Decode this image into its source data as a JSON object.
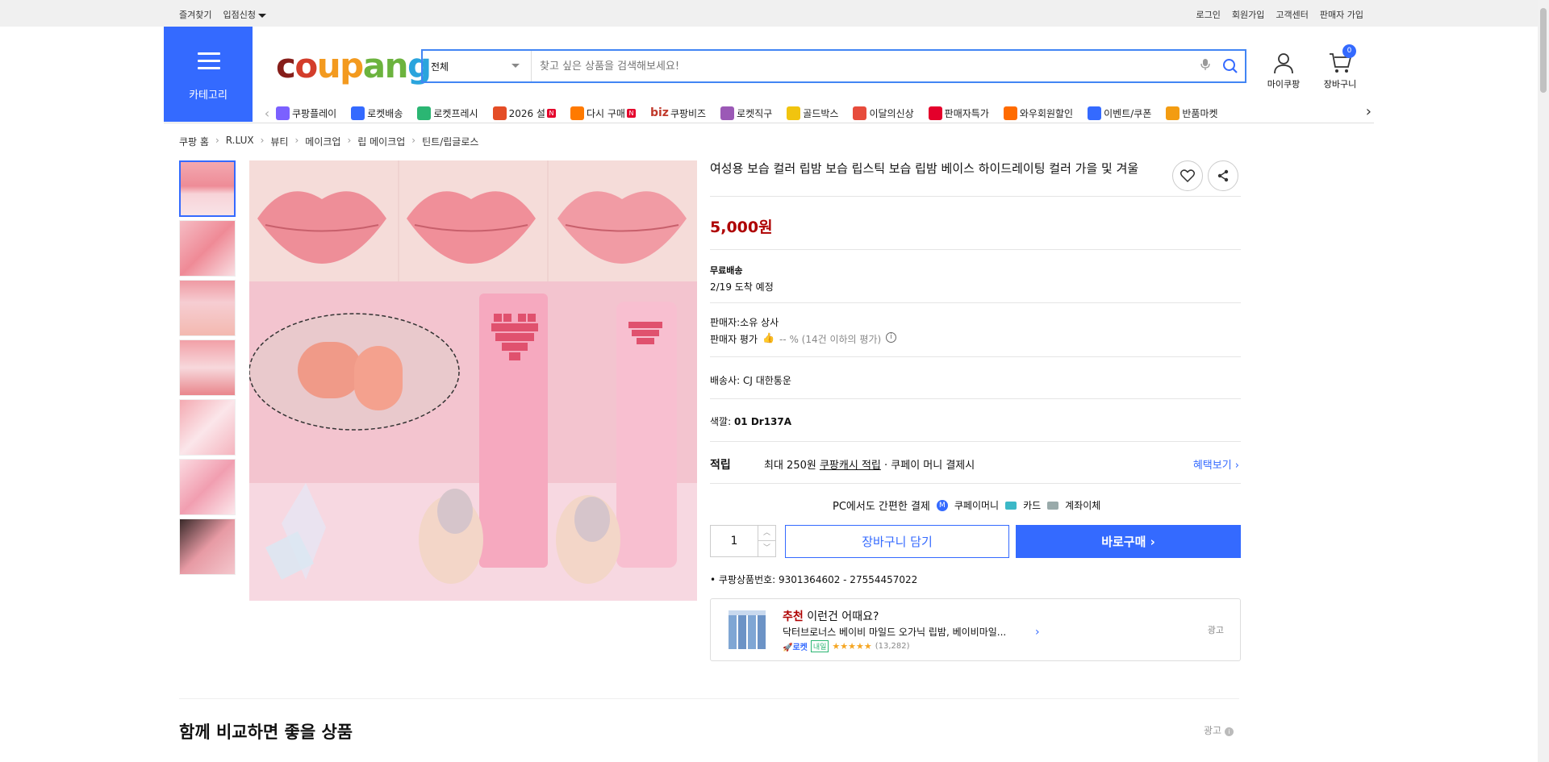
{
  "topbar": {
    "left": [
      "즐겨찾기",
      "입점신청"
    ],
    "right": [
      "로그인",
      "회원가입",
      "고객센터",
      "판매자 가입"
    ]
  },
  "header": {
    "category_label": "카테고리",
    "logo": [
      "c",
      "o",
      "u",
      "p",
      "a",
      "n",
      "g"
    ],
    "search_scope": "전체",
    "search_placeholder": "찾고 싶은 상품을 검색해보세요!",
    "my_coupang": "마이쿠팡",
    "cart": "장바구니",
    "cart_count": "0"
  },
  "nav": [
    {
      "label": "쿠팡플레이",
      "color": "#7b61ff"
    },
    {
      "label": "로켓배송",
      "color": "#346aff"
    },
    {
      "label": "로켓프레시",
      "color": "#2bb673"
    },
    {
      "label": "2026 설",
      "color": "#e44d26",
      "new": "N"
    },
    {
      "label": "다시 구매",
      "color": "#ff7a00",
      "new": "N"
    },
    {
      "label": "쿠팡비즈",
      "prefix": "biz"
    },
    {
      "label": "로켓직구",
      "color": "#9b59b6"
    },
    {
      "label": "골드박스",
      "color": "#f1c40f"
    },
    {
      "label": "이달의신상",
      "color": "#e74c3c"
    },
    {
      "label": "판매자특가",
      "color": "#e4002b"
    },
    {
      "label": "와우회원할인",
      "color": "#ff6b00"
    },
    {
      "label": "이벤트/쿠폰",
      "color": "#346aff"
    },
    {
      "label": "반품마켓",
      "color": "#f39c12"
    }
  ],
  "breadcrumb": [
    "쿠팡 홈",
    "R.LUX",
    "뷰티",
    "메이크업",
    "립 메이크업",
    "틴트/립글로스"
  ],
  "product": {
    "title": "여성용 보습 컬러 립밤 보습 립스틱 보습 립밤 베이스 하이드레이팅 컬러 가을 및 겨울",
    "price": "5,000원",
    "free_shipping": "무료배송",
    "arrival": "2/19 도착 예정",
    "seller": "판매자:소유 상사",
    "seller_rating_label": "판매자 평가",
    "seller_rating_value": "-- % (14건 이하의 평가)",
    "courier": "배송사:  CJ 대한통운",
    "color_label": "색깔:",
    "color_value": "01 Dr137A",
    "reward_label": "적립",
    "reward_text1": "최대 250원",
    "reward_text2": "쿠팡캐시 적립",
    "reward_text3": "· 쿠페이 머니 결제시",
    "benefit_link": "혜택보기",
    "pay_title": "PC에서도 간편한 결제",
    "pay_opts": [
      "쿠페이머니",
      "카드",
      "계좌이체"
    ],
    "quantity": "1",
    "add_to_cart": "장바구니 담기",
    "buy_now": "바로구매",
    "product_no": "쿠팡상품번호: 9301364602 - 27554457022"
  },
  "recommend": {
    "tag": "추천",
    "title": "이런건 어때요?",
    "item": "닥터브로너스 베이비 마일드 오가닉 립밤, 베이비마일...",
    "rocket": "로켓",
    "tomorrow": "내일",
    "stars": "★★★★★",
    "reviews": "(13,282)",
    "ad": "광고"
  },
  "compare": {
    "title": "함께 비교하면 좋을 상품",
    "ad": "광고"
  },
  "colors": {
    "accent": "#346aff",
    "price": "#ae0000"
  }
}
